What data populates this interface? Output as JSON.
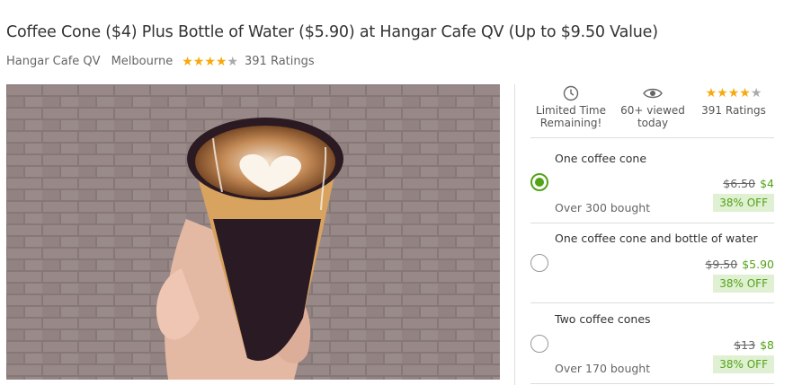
{
  "deal": {
    "title": "Coffee Cone ($4) Plus Bottle of Water ($5.90) at Hangar Cafe QV (Up to $9.50 Value)",
    "merchant": "Hangar Cafe QV",
    "location": "Melbourne",
    "rating": 4,
    "ratings_count": "391 Ratings"
  },
  "stats": {
    "limited": {
      "line1": "Limited Time",
      "line2": "Remaining!",
      "icon": "clock-icon"
    },
    "viewed": {
      "line1": "60+ viewed",
      "line2": "today",
      "icon": "eye-icon"
    },
    "ratings": {
      "label": "391 Ratings",
      "rating": 4
    }
  },
  "options": [
    {
      "title": "One coffee cone",
      "old_price": "$6.50",
      "new_price": "$4",
      "discount": "38% OFF",
      "bought": "Over 300 bought",
      "selected": true
    },
    {
      "title": "One coffee cone and bottle of water",
      "old_price": "$9.50",
      "new_price": "$5.90",
      "discount": "38% OFF",
      "bought": "",
      "selected": false
    },
    {
      "title": "Two coffee cones",
      "old_price": "$13",
      "new_price": "$8",
      "discount": "38% OFF",
      "bought": "Over 170 bought",
      "selected": false
    }
  ],
  "colors": {
    "accent": "#53a318",
    "star": "#f7a90a",
    "badge_bg": "#e0f0d3"
  }
}
